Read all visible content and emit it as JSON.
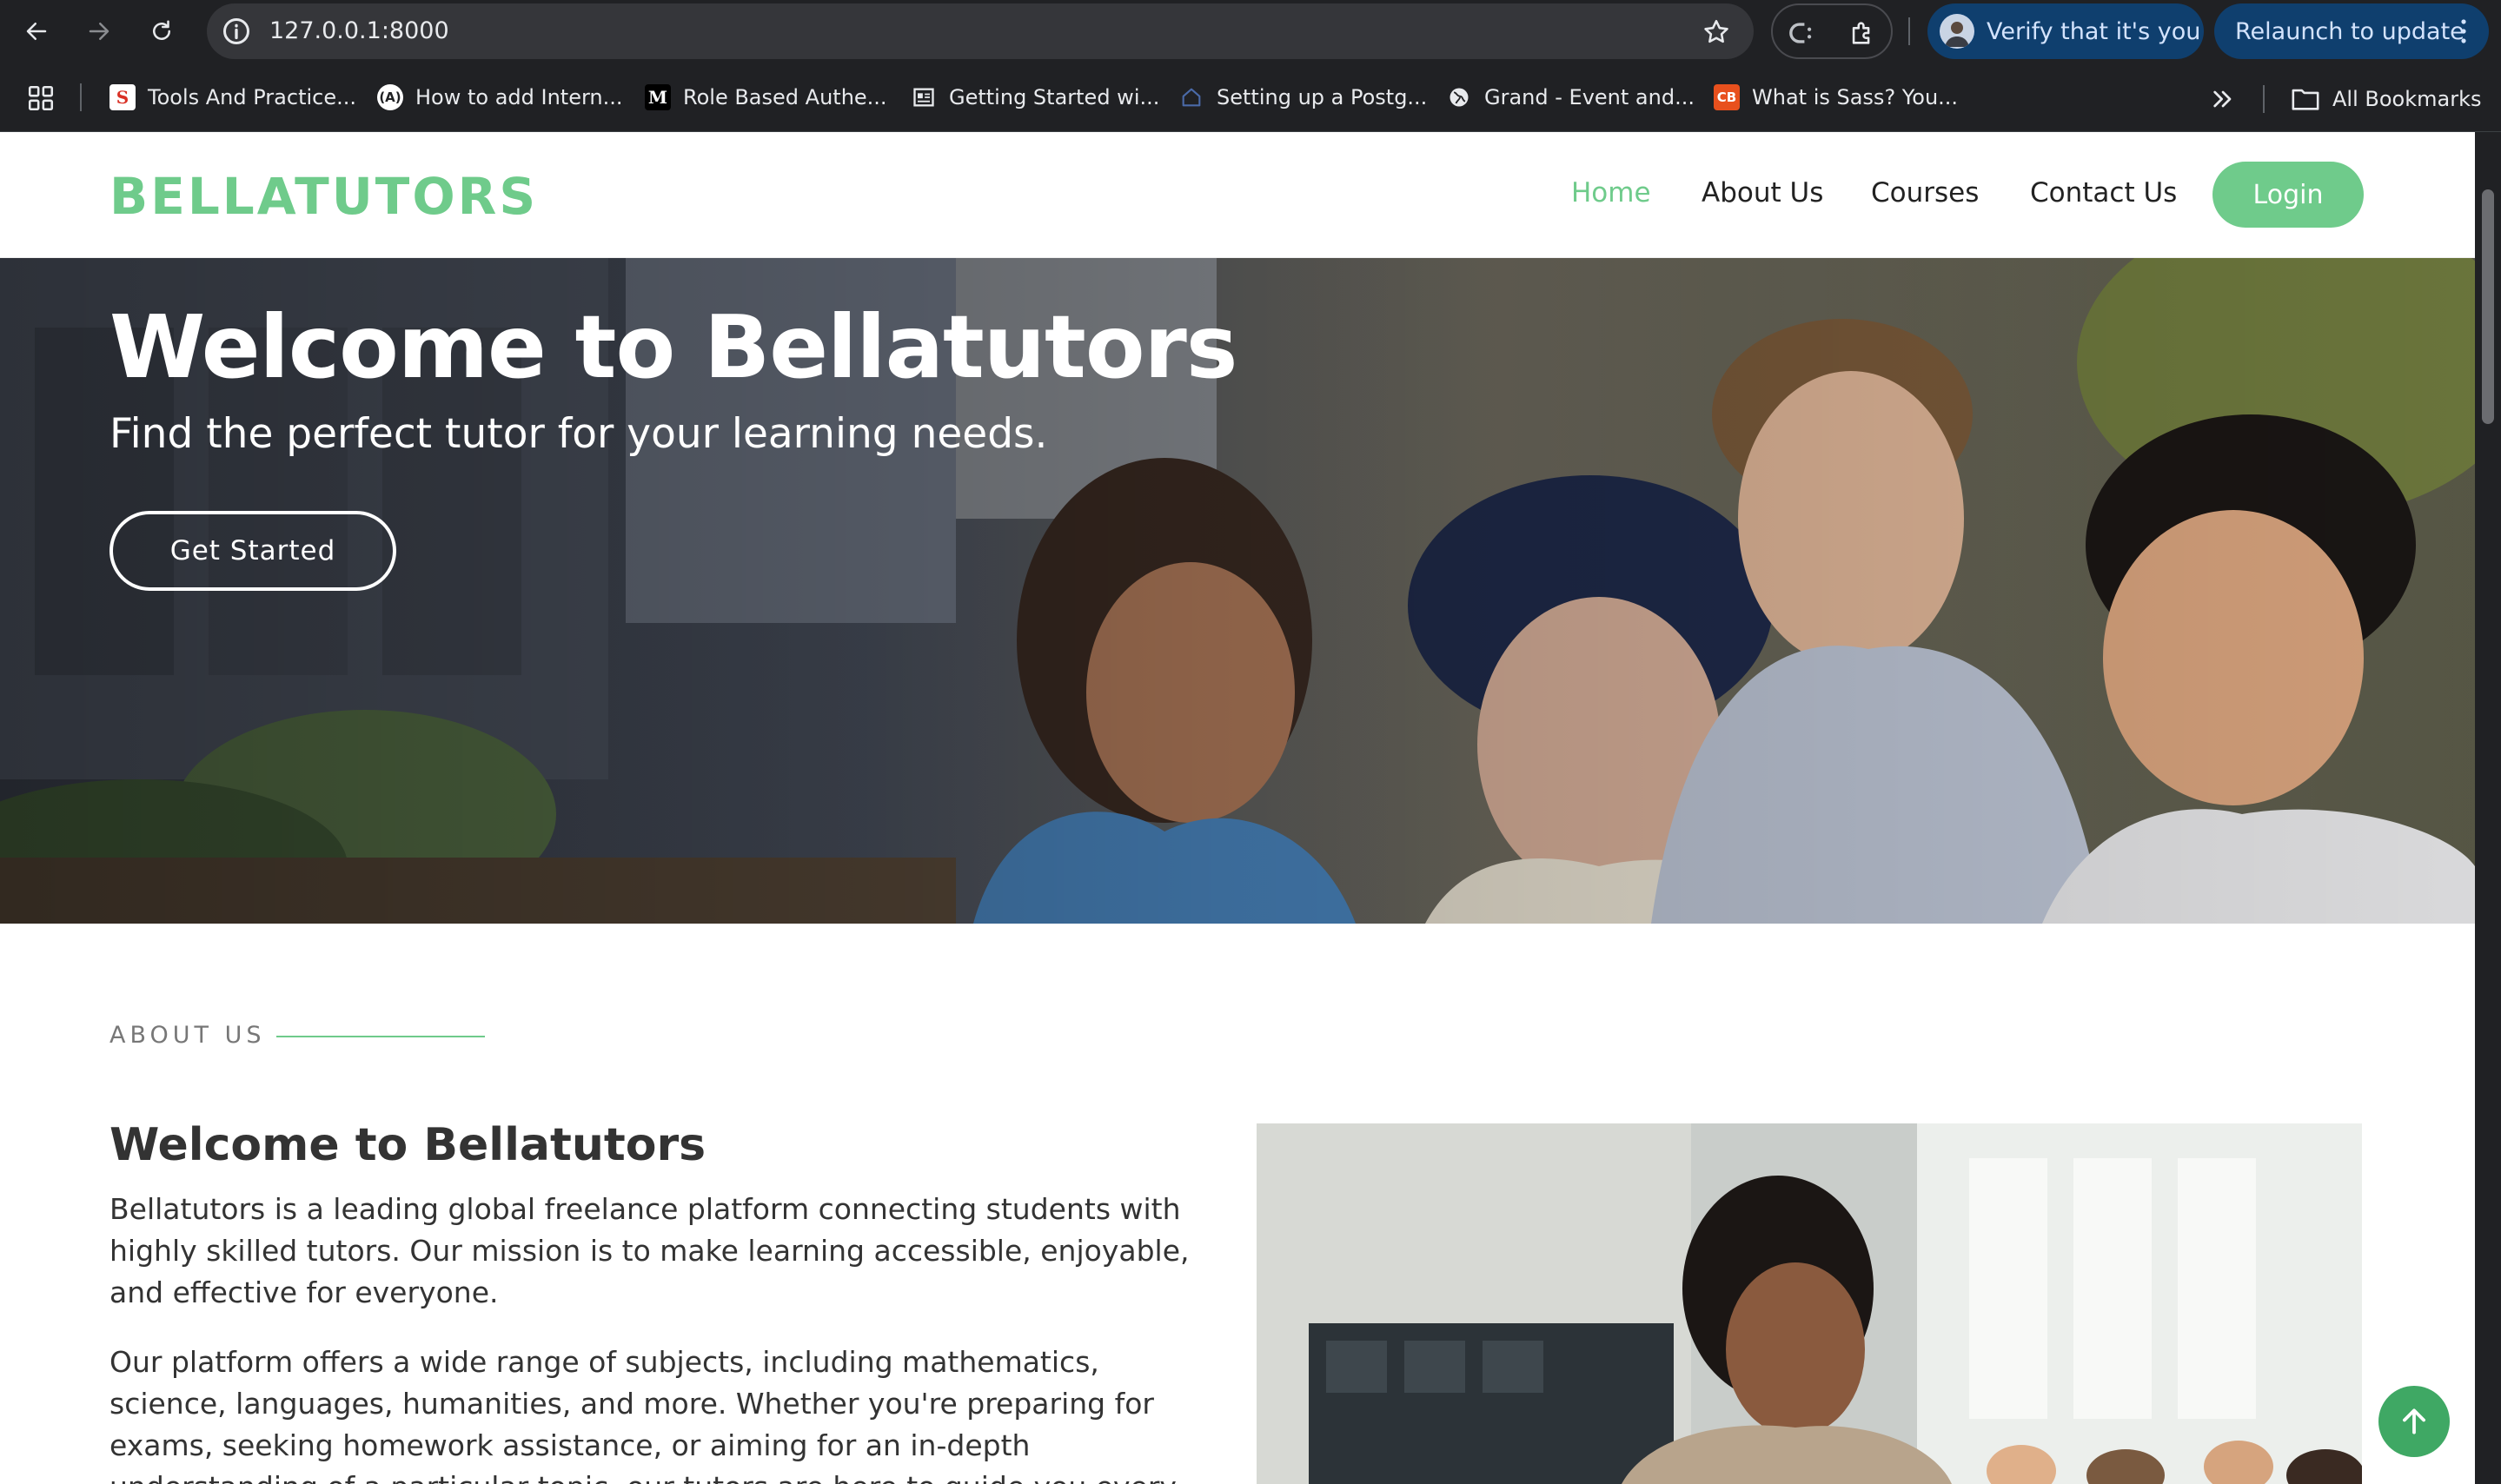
{
  "browser": {
    "url": "127.0.0.1:8000",
    "verify_label": "Verify that it's you",
    "relaunch_label": "Relaunch to update",
    "bookmarks": [
      {
        "label": "Tools And Practice...",
        "icon": "S"
      },
      {
        "label": "How to add Intern...",
        "icon": "(A)"
      },
      {
        "label": "Role Based Authe...",
        "icon": "M"
      },
      {
        "label": "Getting Started wi...",
        "icon": "doc"
      },
      {
        "label": "Setting up a Postg...",
        "icon": "house"
      },
      {
        "label": "Grand - Event and...",
        "icon": "globe"
      },
      {
        "label": "What is Sass? You...",
        "icon": "CB"
      }
    ],
    "all_bookmarks": "All Bookmarks"
  },
  "site": {
    "logo": "BELLATUTORS",
    "nav": [
      "Home",
      "About Us",
      "Courses",
      "Contact Us"
    ],
    "login": "Login",
    "accent_color": "#6fcb8b"
  },
  "hero": {
    "title": "Welcome to Bellatutors",
    "subtitle": "Find the perfect tutor for your learning needs.",
    "cta": "Get Started"
  },
  "about": {
    "label": "ABOUT US",
    "heading": "Welcome to Bellatutors",
    "p1": "Bellatutors is a leading global freelance platform connecting students with highly skilled tutors. Our mission is to make learning accessible, enjoyable, and effective for everyone.",
    "p2": "Our platform offers a wide range of subjects, including mathematics, science, languages, humanities, and more. Whether you're preparing for exams, seeking homework assistance, or aiming for an in-depth understanding of a particular topic, our tutors are here to guide you every step of the way."
  }
}
